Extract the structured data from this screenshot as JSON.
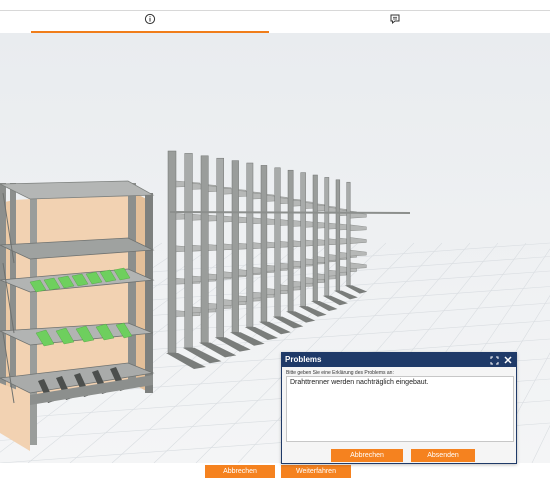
{
  "tabs": [
    {
      "icon": "info-icon",
      "active": true
    },
    {
      "icon": "feedback-icon",
      "active": false
    }
  ],
  "footer": {
    "cancel_label": "Abbrechen",
    "continue_label": "Weiterfahren"
  },
  "dialog": {
    "title": "Problems",
    "instruction": "Bitte geben Sie eine Erklärung des Problems an:",
    "text_value": "Drahttrenner werden nachträglich eingebaut.",
    "cancel_label": "Abbrechen",
    "submit_label": "Absenden",
    "header_icons": [
      "expand-icon",
      "close-icon"
    ]
  },
  "scene": {
    "objects": [
      "shelving-rack",
      "cantilever-rack"
    ],
    "colors": {
      "accent": "#f5821f",
      "dialog_header": "#1f3a68",
      "rack_frame": "#8c8f8d",
      "shelf_panel": "#f2d2b2",
      "wire_divider": "#6ecf5e"
    }
  }
}
